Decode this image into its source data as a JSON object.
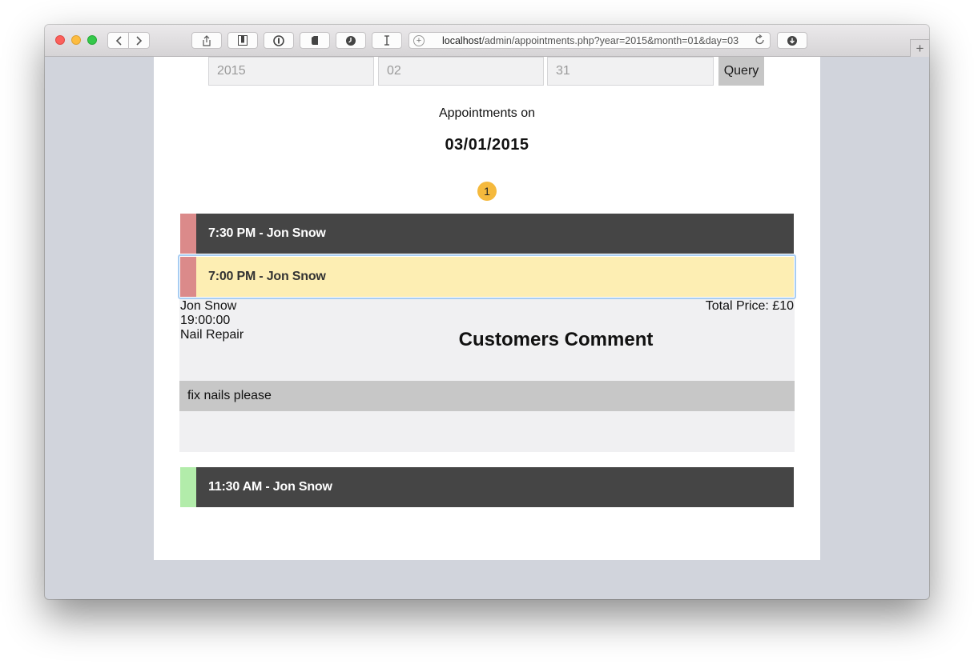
{
  "browser": {
    "url_host": "localhost",
    "url_path": "/admin/appointments.php?year=2015&month=01&day=03"
  },
  "query": {
    "year_value": "2015",
    "month_value": "02",
    "day_value": "31",
    "button_label": "Query"
  },
  "heading": {
    "label": "Appointments on",
    "date": "03/01/2015",
    "count": "1"
  },
  "appointments": [
    {
      "title": "7:30 PM - Jon Snow",
      "status_color": "#db8a8a",
      "expanded": false
    },
    {
      "title": "7:00 PM - Jon Snow",
      "status_color": "#db8a8a",
      "expanded": true
    },
    {
      "title": "11:30 AM - Jon Snow",
      "status_color": "#b2ecaa",
      "expanded": false
    }
  ],
  "details": {
    "customer": "Jon Snow",
    "time": "19:00:00",
    "service": "Nail Repair",
    "total_price": "Total Price: £10",
    "comment_heading": "Customers Comment",
    "comment": "fix nails please"
  },
  "colors": {
    "row_bg": "#454545",
    "active_row_bg": "#fdeeb3",
    "badge": "#f5b93c",
    "window_bg": "#d1d4dc"
  },
  "icons": [
    "back-icon",
    "forward-icon",
    "share-icon",
    "reading-list-icon",
    "password-icon",
    "evernote-icon",
    "history-icon",
    "text-cursor-icon",
    "add-icon",
    "reload-icon",
    "download-icon",
    "new-tab-icon"
  ]
}
